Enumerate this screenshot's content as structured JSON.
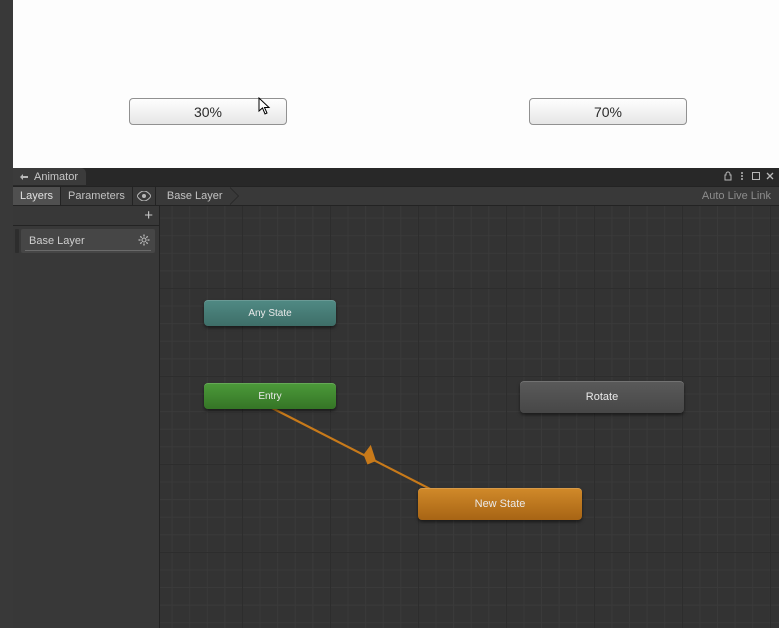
{
  "game": {
    "buttons": {
      "b30": "30%",
      "b70": "70%"
    }
  },
  "animator": {
    "tab_title": "Animator",
    "toolbar": {
      "layers": "Layers",
      "parameters": "Parameters",
      "breadcrumb": "Base Layer",
      "live_link": "Auto Live Link"
    },
    "sidebar": {
      "add_label": "+",
      "layers": [
        {
          "name": "Base Layer"
        }
      ]
    },
    "graph": {
      "nodes": {
        "any_state": "Any State",
        "entry": "Entry",
        "rotate": "Rotate",
        "new_state": "New State"
      }
    }
  }
}
